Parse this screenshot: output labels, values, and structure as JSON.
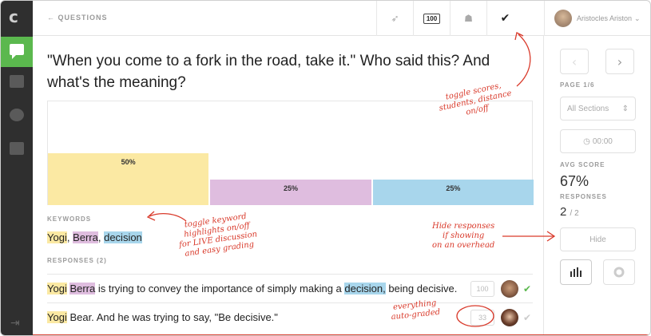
{
  "header": {
    "back_label": "QUESTIONS",
    "score_badge": "100",
    "user_name": "Aristocles Ariston"
  },
  "question": {
    "text": "\"When you come to a fork in the road, take it.\" Who said this? And what's the meaning?"
  },
  "chart_data": {
    "type": "bar",
    "categories": [
      "Yogi",
      "Berra",
      "decision"
    ],
    "values": [
      50,
      25,
      25
    ],
    "labels": [
      "50%",
      "25%",
      "25%"
    ],
    "colors": [
      "#fbe9a3",
      "#dfbddf",
      "#a8d6ec"
    ],
    "ylim": [
      0,
      100
    ]
  },
  "keywords": {
    "label": "KEYWORDS",
    "items": [
      {
        "text": "Yogi",
        "color": "#fbe9a3"
      },
      {
        "text": "Berra",
        "color": "#dfbddf"
      },
      {
        "text": "decision",
        "color": "#a8d6ec"
      }
    ]
  },
  "responses": {
    "label": "RESPONSES (2)",
    "items": [
      {
        "segments": [
          {
            "text": "Yogi",
            "hl": "yellow"
          },
          {
            "text": " "
          },
          {
            "text": "Berra",
            "hl": "purple"
          },
          {
            "text": " is trying to convey the importance of simply making a "
          },
          {
            "text": "decision,",
            "hl": "blue"
          },
          {
            "text": " being decisive."
          }
        ],
        "score": "100",
        "graded": true
      },
      {
        "segments": [
          {
            "text": "Yogi",
            "hl": "yellow"
          },
          {
            "text": " Bear. And he was trying to say, \"Be decisive.\""
          }
        ],
        "score": "33",
        "graded": false
      }
    ]
  },
  "sidebar": {
    "page_label": "PAGE 1/6",
    "section_select": "All Sections",
    "timer": "00:00",
    "avg_score_label": "AVG SCORE",
    "avg_score": "67%",
    "responses_label": "RESPONSES",
    "responses_count": "2",
    "responses_total": "/ 2",
    "hide_label": "Hide"
  },
  "annotations": {
    "toggle_scores": "toggle scores,\nstudents, distance\non/off",
    "toggle_keywords": "toggle keyword\nhighlights on/off\nfor LIVE discussion\nand easy grading",
    "hide_responses": "Hide responses\nif showing\non an overhead",
    "auto_graded": "everything\nauto-graded"
  },
  "colors": {
    "accent_green": "#5bb84e",
    "annotation_red": "#d93a2b",
    "sidebar_dark": "#2f2f2f"
  }
}
